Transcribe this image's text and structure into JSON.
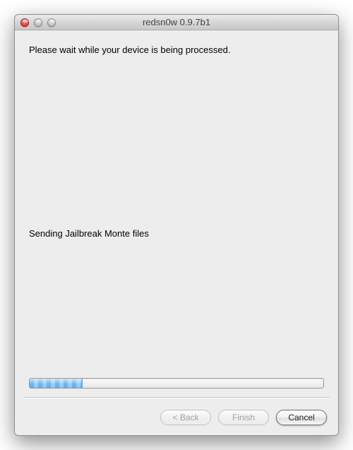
{
  "window": {
    "title": "redsn0w 0.9.7b1"
  },
  "content": {
    "instruction": "Please wait while your device is being processed.",
    "status": "Sending Jailbreak Monte files",
    "progress_percent": 18
  },
  "buttons": {
    "back": "< Back",
    "finish": "Finish",
    "cancel": "Cancel"
  }
}
